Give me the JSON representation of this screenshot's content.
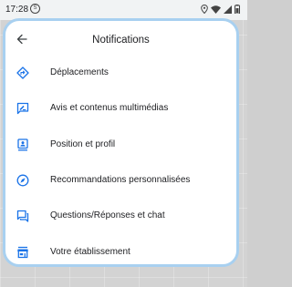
{
  "status_bar": {
    "time": "17:28",
    "time_badge": "S"
  },
  "header": {
    "title": "Notifications",
    "back_icon": "arrow-back-icon"
  },
  "menu": [
    {
      "label": "Déplacements",
      "icon": "directions-icon"
    },
    {
      "label": "Avis et contenus multimédias",
      "icon": "rate-review-icon"
    },
    {
      "label": "Position et profil",
      "icon": "contact-card-icon"
    },
    {
      "label": "Recommandations personnalisées",
      "icon": "explore-icon"
    },
    {
      "label": "Questions/Réponses et chat",
      "icon": "question-answer-icon"
    },
    {
      "label": "Votre établissement",
      "icon": "storefront-icon"
    }
  ],
  "colors": {
    "accent": "#1a73e8",
    "sheet_border": "#a8d0f0",
    "text": "#202124"
  }
}
